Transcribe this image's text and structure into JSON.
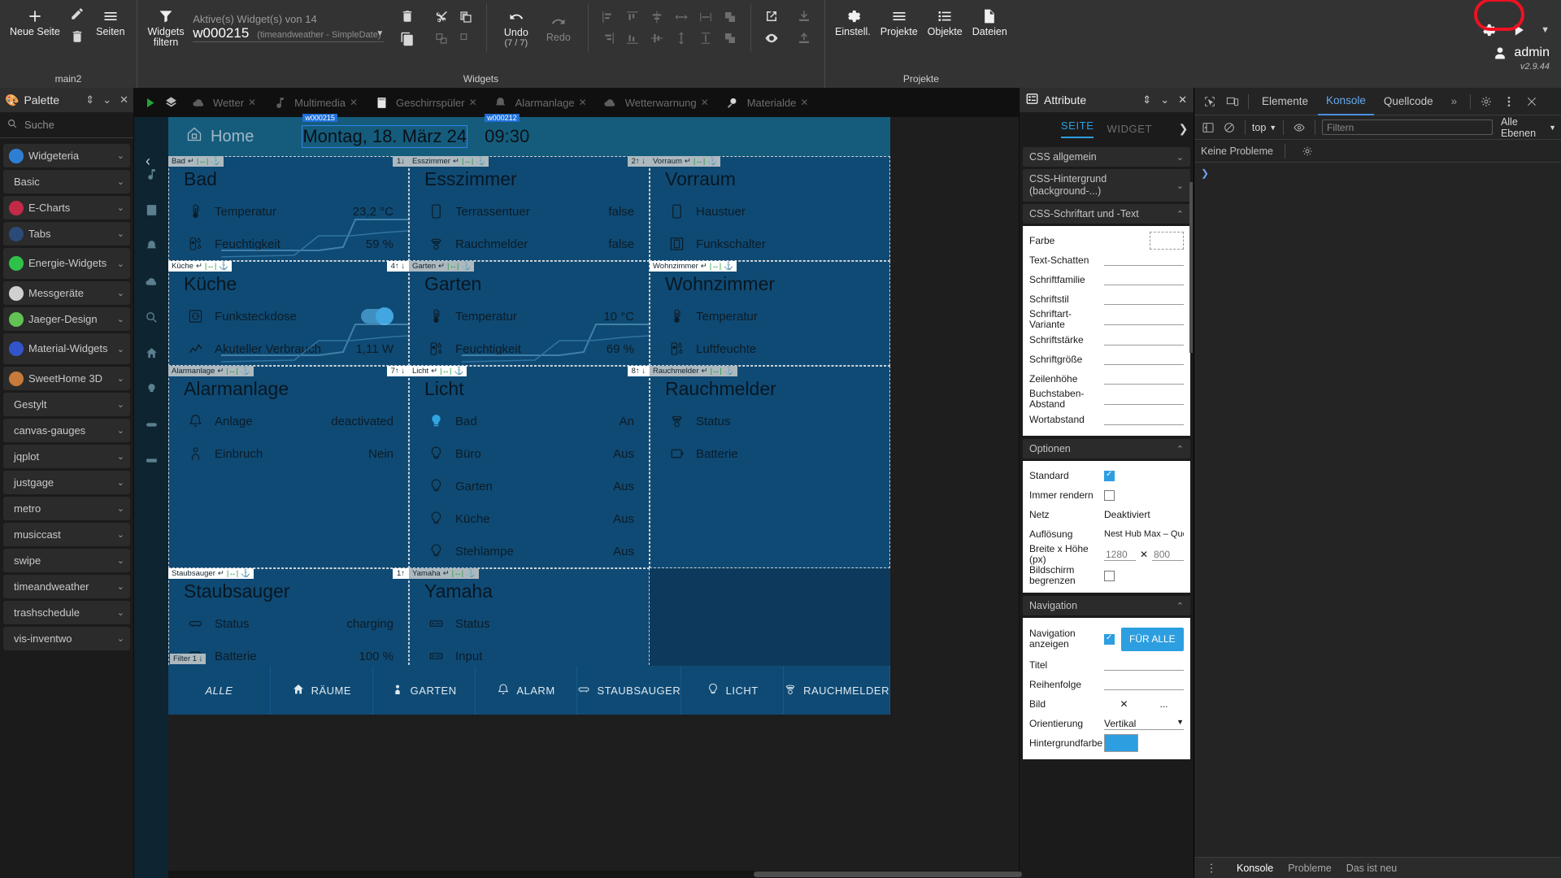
{
  "ribbon": {
    "pages_group": {
      "caption": "main2",
      "new_page": "Neue Seite",
      "edit_icon": "pencil-icon",
      "delete_icon": "trash-icon",
      "pages": "Seiten"
    },
    "widgets_group": {
      "caption": "Widgets",
      "filter_label": "Widgets filtern",
      "active_widgets": "Aktive(s) Widget(s) von 14",
      "selected_widget": "w000215",
      "selected_widget_type": "(timeandweather - SimpleDate)",
      "undo": "Undo",
      "undo_count": "(7 / 7)",
      "redo": "Redo"
    },
    "projects_group": {
      "caption": "Projekte",
      "items": [
        {
          "label": "Einstell.",
          "icon": "gear-icon"
        },
        {
          "label": "Projekte",
          "icon": "hamburger-icon"
        },
        {
          "label": "Objekte",
          "icon": "list-icon"
        },
        {
          "label": "Dateien",
          "icon": "files-icon"
        }
      ]
    },
    "user": {
      "name": "admin",
      "version": "v2.9.44",
      "gear_icon": "gear-icon",
      "play_icon": "play-icon",
      "caret_icon": "chevron-down-icon",
      "highlight_color": "#ee1122"
    }
  },
  "palette": {
    "title": "Palette",
    "search_placeholder": "Suche",
    "items": [
      {
        "label": "Widgeteria",
        "icon": "widgeteria-icon",
        "color": "#2e7fd4"
      },
      {
        "label": "Basic",
        "icon": "",
        "color": ""
      },
      {
        "label": "E-Charts",
        "icon": "echarts-icon",
        "color": "#c22a48"
      },
      {
        "label": "Tabs",
        "icon": "tabs-icon",
        "color": "#2b4a78"
      },
      {
        "label": "Energie-Widgets",
        "icon": "energy-icon",
        "color": "#2fc24a"
      },
      {
        "label": "Messgeräte",
        "icon": "gauge-icon",
        "color": "#d0d0d0"
      },
      {
        "label": "Jaeger-Design",
        "icon": "jaeger-icon",
        "color": "#62c254"
      },
      {
        "label": "Material-Widgets",
        "icon": "material-icon",
        "color": "#3355cc"
      },
      {
        "label": "SweetHome 3D",
        "icon": "sweethome-icon",
        "color": "#c77a3a"
      },
      {
        "label": "Gestylt",
        "icon": "",
        "color": ""
      },
      {
        "label": "canvas-gauges",
        "icon": "",
        "color": ""
      },
      {
        "label": "jqplot",
        "icon": "",
        "color": ""
      },
      {
        "label": "justgage",
        "icon": "",
        "color": ""
      },
      {
        "label": "metro",
        "icon": "",
        "color": ""
      },
      {
        "label": "musiccast",
        "icon": "",
        "color": ""
      },
      {
        "label": "swipe",
        "icon": "",
        "color": ""
      },
      {
        "label": "timeandweather",
        "icon": "",
        "color": ""
      },
      {
        "label": "trashschedule",
        "icon": "",
        "color": ""
      },
      {
        "label": "vis-inventwo",
        "icon": "",
        "color": ""
      }
    ]
  },
  "canvas": {
    "tabs": [
      {
        "label": "Wetter",
        "icon": "cloud-icon"
      },
      {
        "label": "Multimedia",
        "icon": "music-icon"
      },
      {
        "label": "Geschirrspüler",
        "icon": "dishwasher-icon"
      },
      {
        "label": "Alarmanlage",
        "icon": "alarm-icon"
      },
      {
        "label": "Wetterwarnung",
        "icon": "cloud-icon"
      },
      {
        "label": "Materialde",
        "icon": "magnifier-icon"
      }
    ],
    "header": {
      "home_label": "Home",
      "date": "Montag, 18. März 24",
      "time": "09:30",
      "date_tag": "w000215",
      "time_tag": "w000212"
    },
    "cards": [
      {
        "title": "Bad",
        "tag": "Bad",
        "ztag": "1↓",
        "rows": [
          {
            "icon": "thermometer-icon",
            "label": "Temperatur",
            "value": "23,2 °C",
            "spark": true
          },
          {
            "icon": "humidity-icon",
            "label": "Feuchtigkeit",
            "value": "59 %"
          }
        ]
      },
      {
        "title": "Esszimmer",
        "tag": "Esszimmer",
        "ztag": "2↑ ↓",
        "rows": [
          {
            "icon": "door-icon",
            "label": "Terrassentuer",
            "value": "false"
          },
          {
            "icon": "smoke-icon",
            "label": "Rauchmelder",
            "value": "false"
          }
        ]
      },
      {
        "title": "Vorraum",
        "tag": "Vorraum",
        "ztag": "",
        "rows": [
          {
            "icon": "door-icon",
            "label": "Haustuer",
            "value": ""
          },
          {
            "icon": "switch-icon",
            "label": "Funkschalter",
            "value": ""
          }
        ]
      },
      {
        "title": "Küche",
        "tag": "Küche",
        "ztag": "4↑ ↓",
        "rows": [
          {
            "icon": "socket-icon",
            "label": "Funksteckdose",
            "value": "",
            "toggle": true
          },
          {
            "icon": "chart-icon",
            "label": "Akuteller Verbrauch",
            "value": "1,11 W",
            "spark": true
          }
        ]
      },
      {
        "title": "Garten",
        "tag": "Garten",
        "ztag": "",
        "rows": [
          {
            "icon": "thermometer-icon",
            "label": "Temperatur",
            "value": "10 °C",
            "spark": true
          },
          {
            "icon": "humidity-icon",
            "label": "Feuchtigkeit",
            "value": "69 %",
            "spark": true
          }
        ]
      },
      {
        "title": "Wohnzimmer",
        "tag": "Wohnzimmer",
        "ztag": "",
        "rows": [
          {
            "icon": "thermometer-icon",
            "label": "Temperatur",
            "value": ""
          },
          {
            "icon": "humidity-icon",
            "label": "Luftfeuchte",
            "value": ""
          }
        ]
      },
      {
        "title": "Alarmanlage",
        "tag": "Alarmanlage",
        "ztag": "7↑ ↓",
        "rows": [
          {
            "icon": "alarm-icon",
            "label": "Anlage",
            "value": "deactivated"
          },
          {
            "icon": "burglar-icon",
            "label": "Einbruch",
            "value": "Nein"
          }
        ]
      },
      {
        "title": "Licht",
        "tag": "Licht",
        "ztag": "8↑ ↓",
        "rows": [
          {
            "icon": "bulb-on-icon",
            "label": "Bad",
            "value": "An"
          },
          {
            "icon": "bulb-off-icon",
            "label": "Büro",
            "value": "Aus"
          },
          {
            "icon": "bulb-off-icon",
            "label": "Garten",
            "value": "Aus"
          },
          {
            "icon": "bulb-off-icon",
            "label": "Küche",
            "value": "Aus"
          },
          {
            "icon": "bulb-off-icon",
            "label": "Stehlampe",
            "value": "Aus"
          }
        ]
      },
      {
        "title": "Rauchmelder",
        "tag": "Rauchmelder",
        "ztag": "",
        "rows": [
          {
            "icon": "smoke-icon",
            "label": "Status",
            "value": ""
          },
          {
            "icon": "battery-icon",
            "label": "Batterie",
            "value": ""
          }
        ]
      },
      {
        "title": "Staubsauger",
        "tag": "Staubsauger",
        "ztag": "1↑",
        "rows": [
          {
            "icon": "vacuum-icon",
            "label": "Status",
            "value": "charging"
          },
          {
            "icon": "battery-icon",
            "label": "Batterie",
            "value": "100 %"
          }
        ]
      },
      {
        "title": "Yamaha",
        "tag": "Yamaha",
        "ztag": "",
        "rows": [
          {
            "icon": "amp-icon",
            "label": "Status",
            "value": ""
          },
          {
            "icon": "amp-icon",
            "label": "Input",
            "value": ""
          }
        ]
      }
    ],
    "filter_tag": "Filter 1 ↓",
    "footer_tabs": [
      {
        "label": "ALLE",
        "icon": "",
        "active": true
      },
      {
        "label": "RÄUME",
        "icon": "home-icon"
      },
      {
        "label": "GARTEN",
        "icon": "garden-icon"
      },
      {
        "label": "ALARM",
        "icon": "alarm-icon"
      },
      {
        "label": "STAUBSAUGER",
        "icon": "vacuum-icon"
      },
      {
        "label": "LICHT",
        "icon": "bulb-off-icon"
      },
      {
        "label": "RAUCHMELDER",
        "icon": "smoke-icon"
      }
    ]
  },
  "attributes": {
    "title": "Attribute",
    "tabs": [
      {
        "label": "SEITE",
        "active": true
      },
      {
        "label": "WIDGET",
        "active": false
      }
    ],
    "accordions": [
      {
        "label": "CSS allgemein",
        "open": false
      },
      {
        "label": "CSS-Hintergrund (background-...)",
        "open": false
      },
      {
        "label": "CSS-Schriftart und -Text",
        "open": true
      }
    ],
    "font_fields": [
      {
        "label": "Farbe",
        "type": "color"
      },
      {
        "label": "Text-Schatten",
        "type": "line"
      },
      {
        "label": "Schriftfamilie",
        "type": "line"
      },
      {
        "label": "Schriftstil",
        "type": "line"
      },
      {
        "label": "Schriftart-Variante",
        "type": "line"
      },
      {
        "label": "Schriftstärke",
        "type": "line"
      },
      {
        "label": "Schriftgröße",
        "type": "line"
      },
      {
        "label": "Zeilenhöhe",
        "type": "line"
      },
      {
        "label": "Buchstaben-Abstand",
        "type": "line"
      },
      {
        "label": "Wortabstand",
        "type": "line"
      }
    ],
    "options": {
      "title": "Optionen",
      "standard_label": "Standard",
      "standard_checked": true,
      "always_render_label": "Immer rendern",
      "always_render_checked": false,
      "net_label": "Netz",
      "net_value": "Deaktiviert",
      "resolution_label": "Auflösung",
      "resolution_value": "Nest Hub Max – Querform",
      "size_label": "Breite x Höhe (px)",
      "width_value": "1280",
      "height_value": "800",
      "limit_label": "Bildschirm begrenzen",
      "limit_checked": false
    },
    "navigation": {
      "title": "Navigation",
      "show_label": "Navigation anzeigen",
      "show_checked": true,
      "for_all_button": "FÜR ALLE",
      "title_label": "Titel",
      "order_label": "Reihenfolge",
      "image_label": "Bild",
      "image_clear": "✕",
      "image_more": "...",
      "orientation_label": "Orientierung",
      "orientation_value": "Vertikal",
      "bgcolor_label": "Hintergrundfarbe"
    }
  },
  "devtools": {
    "tabs": [
      {
        "label": "Elemente",
        "active": false
      },
      {
        "label": "Konsole",
        "active": true
      },
      {
        "label": "Quellcode",
        "active": false
      }
    ],
    "more": "»",
    "gear_icon": "gear-icon",
    "kebab_icon": "kebab-icon",
    "close_icon": "close-icon",
    "context": "top",
    "filter_placeholder": "Filtern",
    "levels": "Alle Ebenen",
    "issues": "Keine Probleme",
    "footer": [
      {
        "label": "Konsole",
        "active": true
      },
      {
        "label": "Probleme",
        "active": false
      },
      {
        "label": "Das ist neu",
        "active": false
      }
    ]
  }
}
